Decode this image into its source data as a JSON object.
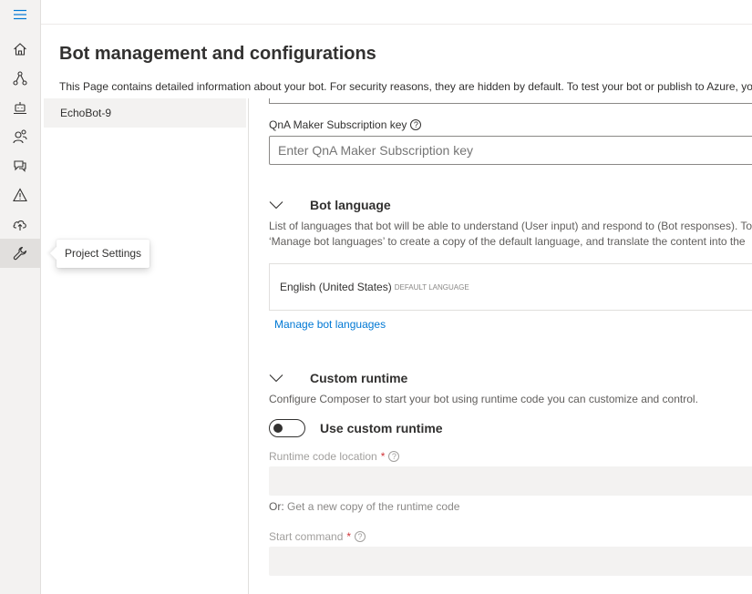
{
  "rail": {
    "items": [
      {
        "name": "hamburger-menu-icon"
      },
      {
        "name": "home-icon"
      },
      {
        "name": "design-flow-icon"
      },
      {
        "name": "bot-responses-icon"
      },
      {
        "name": "user-input-icon"
      },
      {
        "name": "knowledge-base-icon"
      },
      {
        "name": "diagnostics-warning-icon"
      },
      {
        "name": "publish-cloud-icon"
      },
      {
        "name": "project-settings-wrench-icon"
      }
    ],
    "tooltip": "Project Settings",
    "accent": "#0078d4"
  },
  "header": {
    "title": "Bot management and configurations",
    "description": "This Page contains detailed information about your bot. For security reasons, they are hidden by default. To test your bot or publish to Azure, yo"
  },
  "projects": [
    {
      "label": "EchoBot-9"
    }
  ],
  "qna": {
    "label": "QnA Maker Subscription key",
    "placeholder": "Enter QnA Maker Subscription key",
    "help": "?"
  },
  "bot_language": {
    "title": "Bot language",
    "desc_line1": "List of languages that bot will be able to understand (User input) and respond to (Bot responses). To",
    "desc_line2": "‘Manage bot languages’ to create a copy of the default language, and translate the content into the",
    "language": "English (United States)",
    "default_tag": "DEFAULT LANGUAGE",
    "manage_link": "Manage bot languages"
  },
  "custom_runtime": {
    "title": "Custom runtime",
    "description": "Configure Composer to start your bot using runtime code you can customize and control.",
    "toggle_label": "Use custom runtime",
    "toggle_on": false,
    "runtime_location_label": "Runtime code location",
    "required_mark": "*",
    "or_prefix": "Or:",
    "get_copy_link": "Get a new copy of the runtime code",
    "start_command_label": "Start command",
    "help": "?"
  }
}
